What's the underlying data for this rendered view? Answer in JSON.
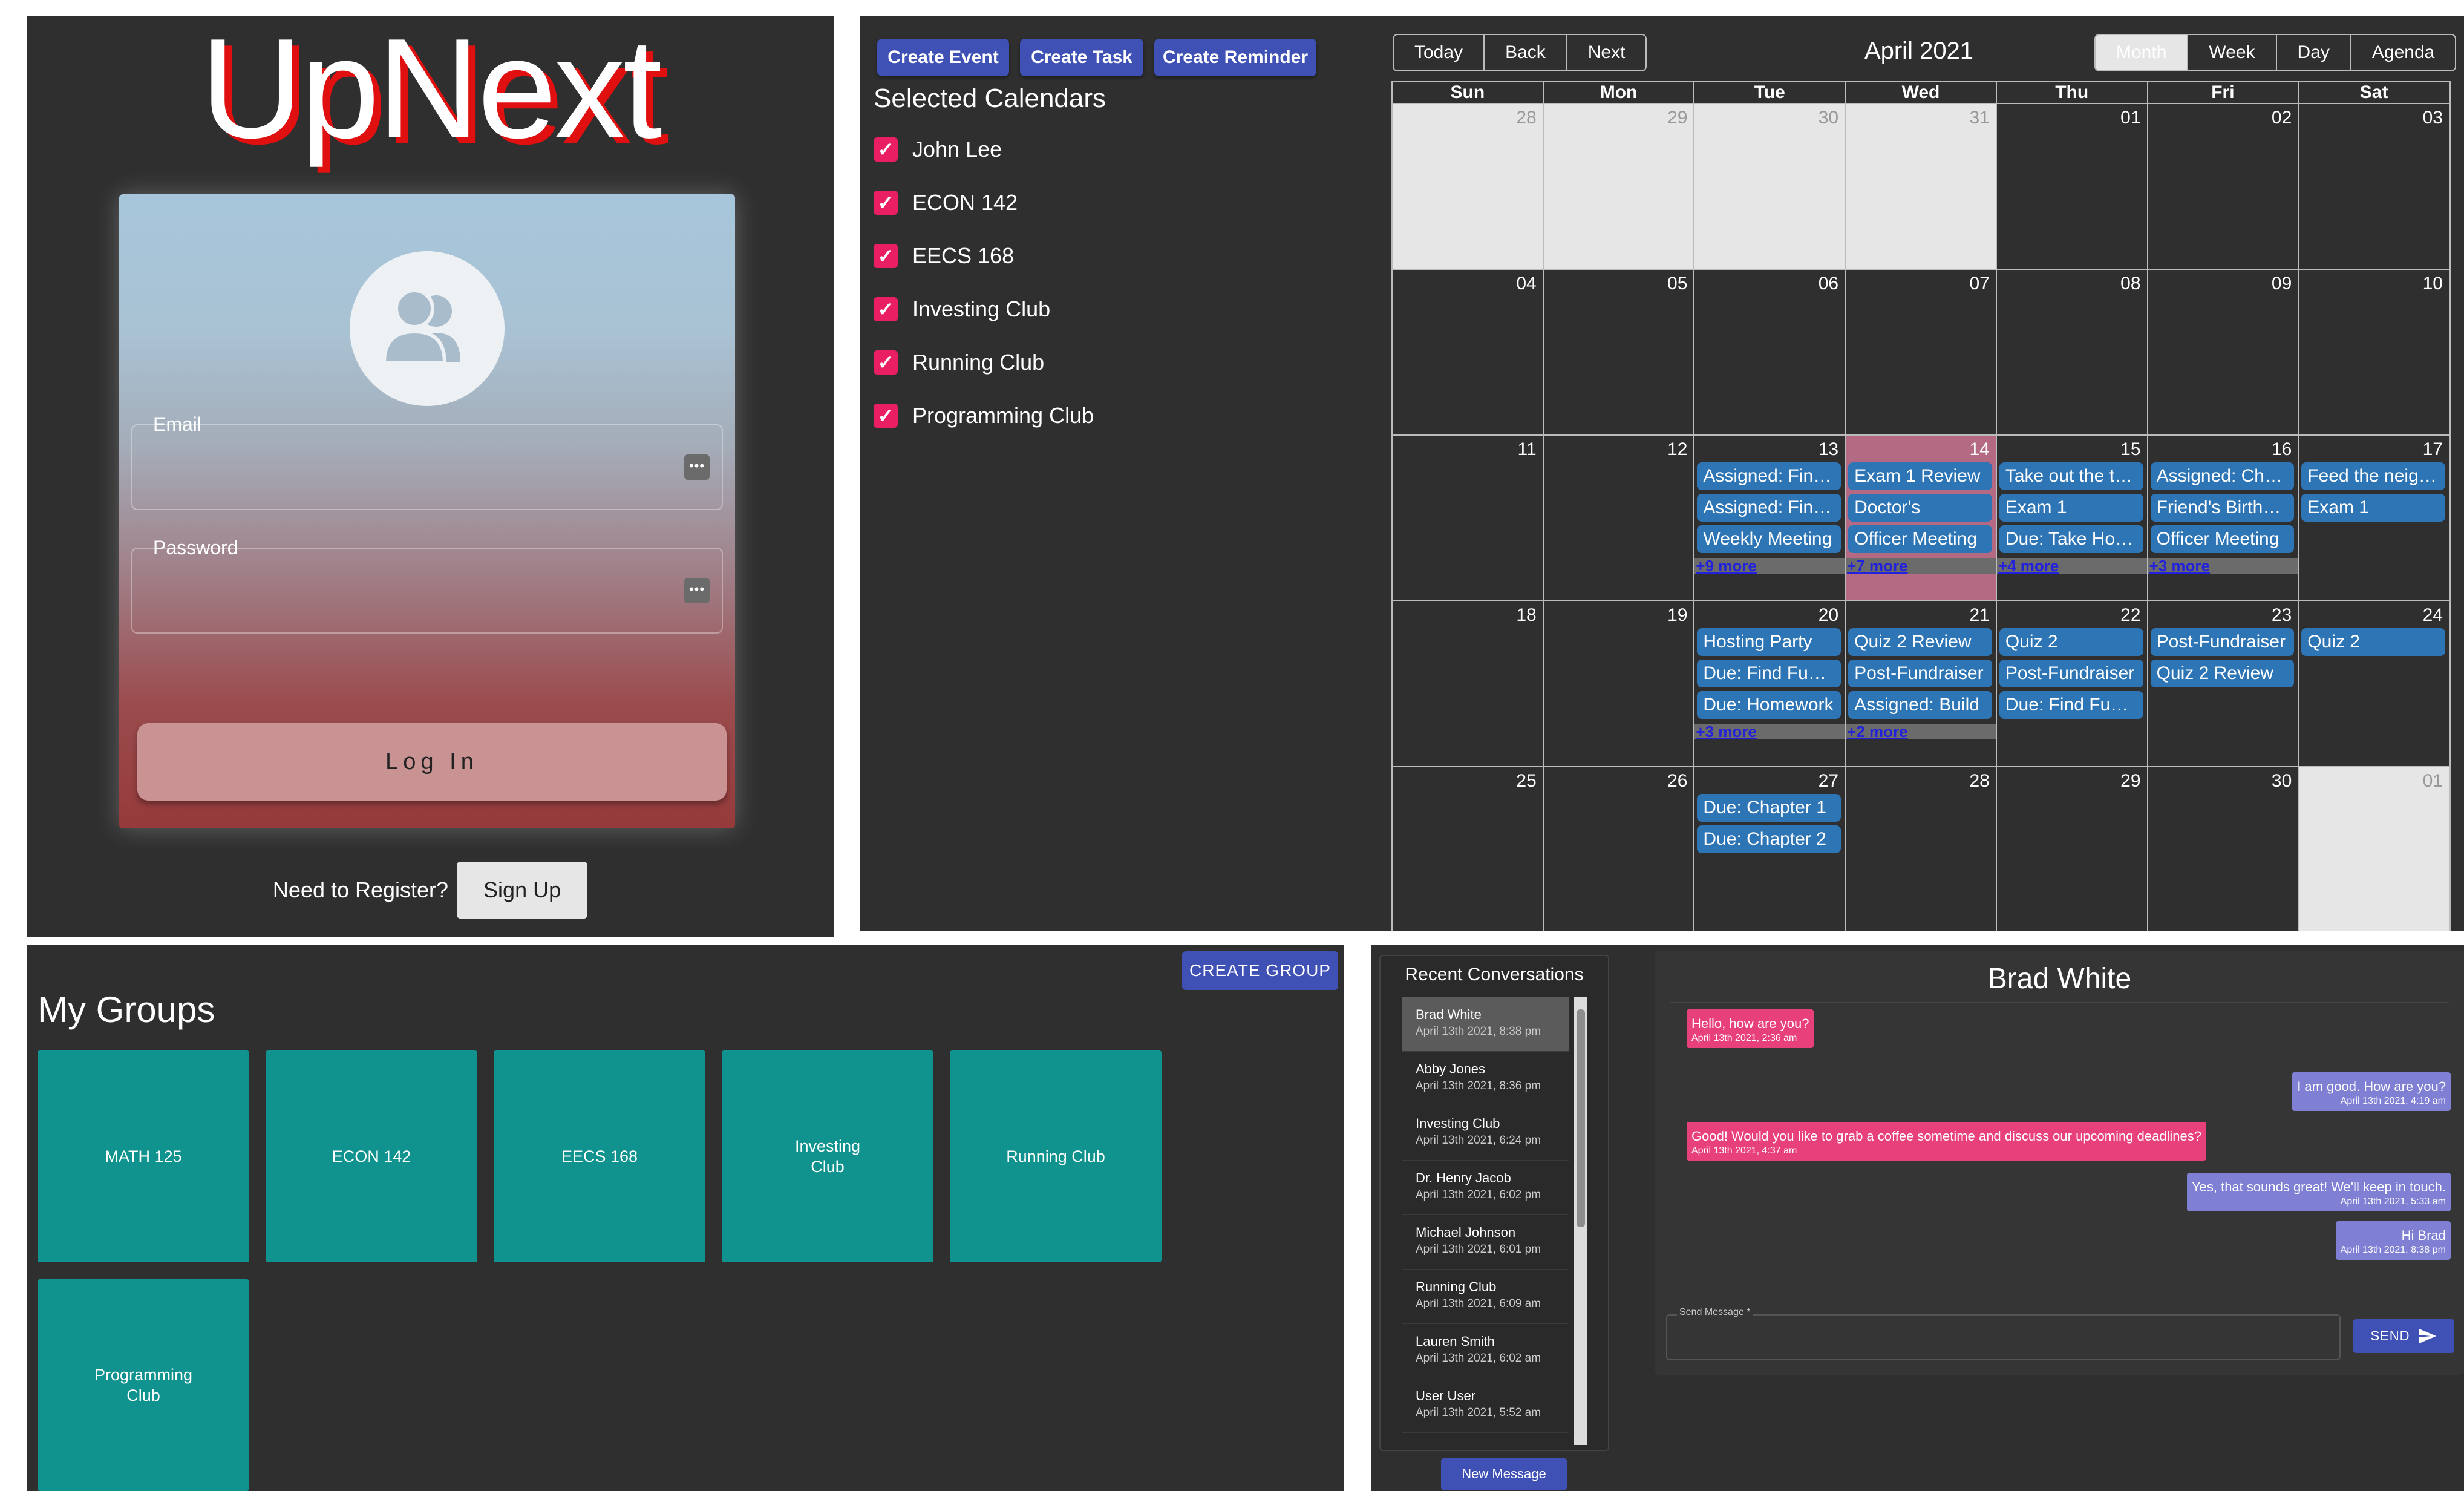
{
  "login": {
    "logo": "UpNext",
    "email_label": "Email",
    "password_label": "Password",
    "key_glyph": "•••",
    "login_button": "Log In",
    "register_prompt": "Need to Register?",
    "signup_button": "Sign Up"
  },
  "calendar": {
    "create_event": "Create Event",
    "create_task": "Create Task",
    "create_reminder": "Create Reminder",
    "selected_title": "Selected Calendars",
    "calendars": [
      "John Lee",
      "ECON 142",
      "EECS 168",
      "Investing Club",
      "Running Club",
      "Programming Club"
    ],
    "nav": [
      "Today",
      "Back",
      "Next"
    ],
    "month_label": "April 2021",
    "views": [
      "Month",
      "Week",
      "Day",
      "Agenda"
    ],
    "active_view": "Month",
    "weekdays": [
      "Sun",
      "Mon",
      "Tue",
      "Wed",
      "Thu",
      "Fri",
      "Sat"
    ],
    "weeks": [
      [
        {
          "d": "28",
          "off": true
        },
        {
          "d": "29",
          "off": true
        },
        {
          "d": "30",
          "off": true
        },
        {
          "d": "31",
          "off": true
        },
        {
          "d": "01"
        },
        {
          "d": "02"
        },
        {
          "d": "03"
        }
      ],
      [
        {
          "d": "04"
        },
        {
          "d": "05"
        },
        {
          "d": "06"
        },
        {
          "d": "07"
        },
        {
          "d": "08"
        },
        {
          "d": "09"
        },
        {
          "d": "10"
        }
      ],
      [
        {
          "d": "11"
        },
        {
          "d": "12"
        },
        {
          "d": "13",
          "events": [
            "Assigned: Final Project",
            "Assigned: Final Exam",
            "Weekly Meeting"
          ],
          "more": "+9 more"
        },
        {
          "d": "14",
          "today": true,
          "events": [
            "Exam 1 Review",
            "Doctor's",
            "Officer Meeting"
          ],
          "more": "+7 more"
        },
        {
          "d": "15",
          "events": [
            "Take out the trash",
            "Exam 1",
            "Due: Take Home Exam"
          ],
          "more": "+4 more"
        },
        {
          "d": "16",
          "events": [
            "Assigned: Chapter",
            "Friend's Birthday",
            "Officer Meeting"
          ],
          "more": "+3 more"
        },
        {
          "d": "17",
          "events": [
            "Feed the neighbor's cat",
            "Exam 1"
          ]
        }
      ],
      [
        {
          "d": "18"
        },
        {
          "d": "19"
        },
        {
          "d": "20",
          "events": [
            "Hosting Party",
            "Due: Find Funding",
            "Due: Homework"
          ],
          "more": "+3 more"
        },
        {
          "d": "21",
          "events": [
            "Quiz 2 Review",
            "Post-Fundraiser",
            "Assigned: Build"
          ],
          "more": "+2 more"
        },
        {
          "d": "22",
          "events": [
            "Quiz 2",
            "Post-Fundraiser",
            "Due: Find Funding"
          ]
        },
        {
          "d": "23",
          "events": [
            "Post-Fundraiser",
            "Quiz 2 Review"
          ]
        },
        {
          "d": "24",
          "events": [
            "Quiz 2"
          ]
        }
      ],
      [
        {
          "d": "25"
        },
        {
          "d": "26"
        },
        {
          "d": "27",
          "events": [
            "Due: Chapter 1",
            "Due: Chapter 2"
          ]
        },
        {
          "d": "28"
        },
        {
          "d": "29"
        },
        {
          "d": "30"
        },
        {
          "d": "01",
          "off": true
        }
      ]
    ],
    "colors": {
      "event": "#2e75b6",
      "today": "#b46a82",
      "check": "#e91e63"
    }
  },
  "groups": {
    "create_button": "CREATE GROUP",
    "title": "My Groups",
    "items": [
      "MATH 125",
      "ECON 142",
      "EECS 168",
      "Investing Club",
      "Running Club",
      "Programming Club"
    ],
    "tile_color": "#10938f"
  },
  "chat": {
    "recent_title": "Recent Conversations",
    "conversations": [
      {
        "name": "Brad White",
        "date": "April 13th 2021, 8:38 pm",
        "active": true
      },
      {
        "name": "Abby Jones",
        "date": "April 13th 2021, 8:36 pm"
      },
      {
        "name": "Investing Club",
        "date": "April 13th 2021, 6:24 pm"
      },
      {
        "name": "Dr. Henry Jacob",
        "date": "April 13th 2021, 6:02 pm"
      },
      {
        "name": "Michael Johnson",
        "date": "April 13th 2021, 6:01 pm"
      },
      {
        "name": "Running Club",
        "date": "April 13th 2021, 6:09 am"
      },
      {
        "name": "Lauren Smith",
        "date": "April 13th 2021, 6:02 am"
      },
      {
        "name": "User User",
        "date": "April 13th 2021, 5:52 am"
      }
    ],
    "new_message": "New Message",
    "partner": "Brad White",
    "messages": [
      {
        "dir": "in",
        "text": "Hello, how are you?",
        "time": "April 13th 2021, 2:36 am"
      },
      {
        "dir": "out",
        "text": "I am good. How are you?",
        "time": "April 13th 2021, 4:19 am"
      },
      {
        "dir": "in",
        "text": "Good! Would you like to grab a coffee sometime and discuss our upcoming deadlines?",
        "time": "April 13th 2021, 4:37 am"
      },
      {
        "dir": "out",
        "text": "Yes, that sounds great! We'll keep in touch.",
        "time": "April 13th 2021, 5:33 am"
      },
      {
        "dir": "out",
        "text": "Hi Brad",
        "time": "April 13th 2021, 8:38 pm"
      }
    ],
    "send_label": "Send Message *",
    "send_button": "SEND"
  }
}
